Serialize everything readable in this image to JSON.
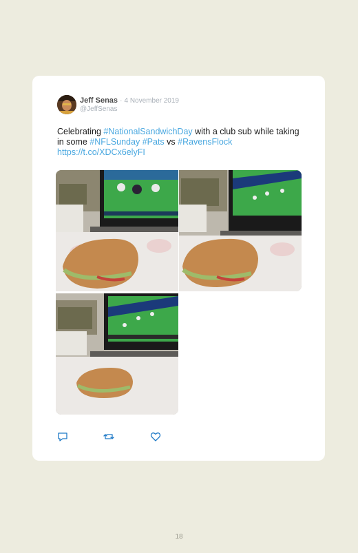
{
  "tweet": {
    "author_name": "Jeff Senas",
    "separator": "·",
    "date": "4 November 2019",
    "handle": "@JeffSenas",
    "text_parts": {
      "p1": "Celebrating ",
      "tag1": "#NationalSandwichDay",
      "p2": " with a club sub while taking in some ",
      "tag2": "#NFLSunday",
      "p3": " ",
      "tag3": "#Pats",
      "p4": " vs ",
      "tag4": "#RavensFlock",
      "link": "https://t.co/XDCx6elyFI"
    },
    "media_count": 3,
    "actions": [
      "reply-icon",
      "retweet-icon",
      "like-icon"
    ]
  },
  "page_number": "18",
  "colors": {
    "background": "#edecdf",
    "card": "#ffffff",
    "hashtag": "#4aa8e0",
    "muted": "#a9b0b8"
  }
}
